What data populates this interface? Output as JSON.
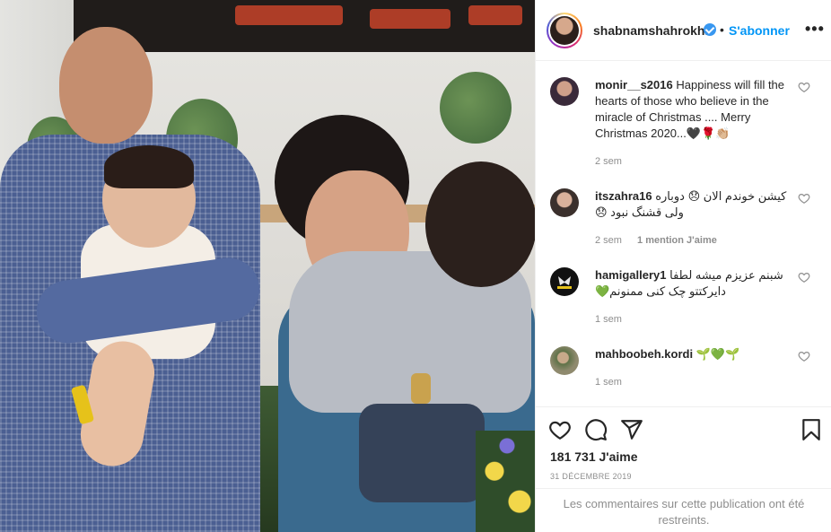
{
  "post": {
    "image_alt_icon": "photo-family-icon"
  },
  "header": {
    "username": "shabnamshahrokhi",
    "verified_icon": "verified-badge-icon",
    "separator": "•",
    "follow_label": "S'abonner",
    "more_label": "•••",
    "follow_color": "#0095f6"
  },
  "comments": [
    {
      "username": "monir__s2016",
      "text": "Happiness will fill the hearts of those who believe in the miracle of Christmas .... Merry Christmas 2020...🖤🌹👏🏼",
      "time": "2 sem",
      "likes": ""
    },
    {
      "username": "itszahra16",
      "text": "کیشن خوندم الان 😞 دوباره ولی قشنگ نبود 😞",
      "time": "2 sem",
      "likes": "1 mention J'aime"
    },
    {
      "username": "hamigallery1",
      "text": "شبنم عزیزم میشه لطفا دایرکتتو چک کنی ممنونم💚",
      "time": "1 sem",
      "likes": ""
    },
    {
      "username": "mahboobeh.kordi",
      "text": "🌱💚🌱",
      "time": "1 sem",
      "likes": ""
    }
  ],
  "actions": {
    "like_icon": "heart-icon",
    "comment_icon": "comment-icon",
    "share_icon": "share-icon",
    "save_icon": "bookmark-icon",
    "likes_count": "181 731 J'aime",
    "date": "31 DÉCEMBRE 2019"
  },
  "restricted_notice": "Les commentaires sur cette publication ont été restreints."
}
